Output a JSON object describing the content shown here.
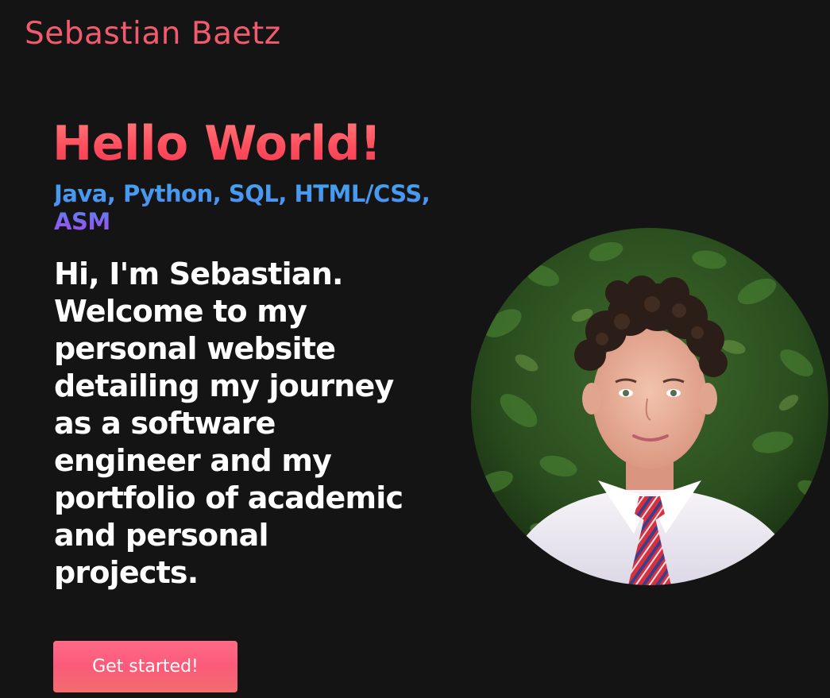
{
  "header": {
    "brand": "Sebastian Baetz"
  },
  "hero": {
    "title": "Hello World!",
    "skills": "Java, Python, SQL, HTML/CSS, ASM",
    "intro": "Hi, I'm Sebastian. Welcome to my personal website detailing my journey as a software engineer and my portfolio of academic and personal projects.",
    "cta_label": "Get started!"
  },
  "colors": {
    "background": "#141414",
    "accent": "#f25a6e",
    "skills_gradient_start": "#3fa5ee",
    "skills_gradient_end": "#9a52ee",
    "button": "#fb5a7a"
  }
}
